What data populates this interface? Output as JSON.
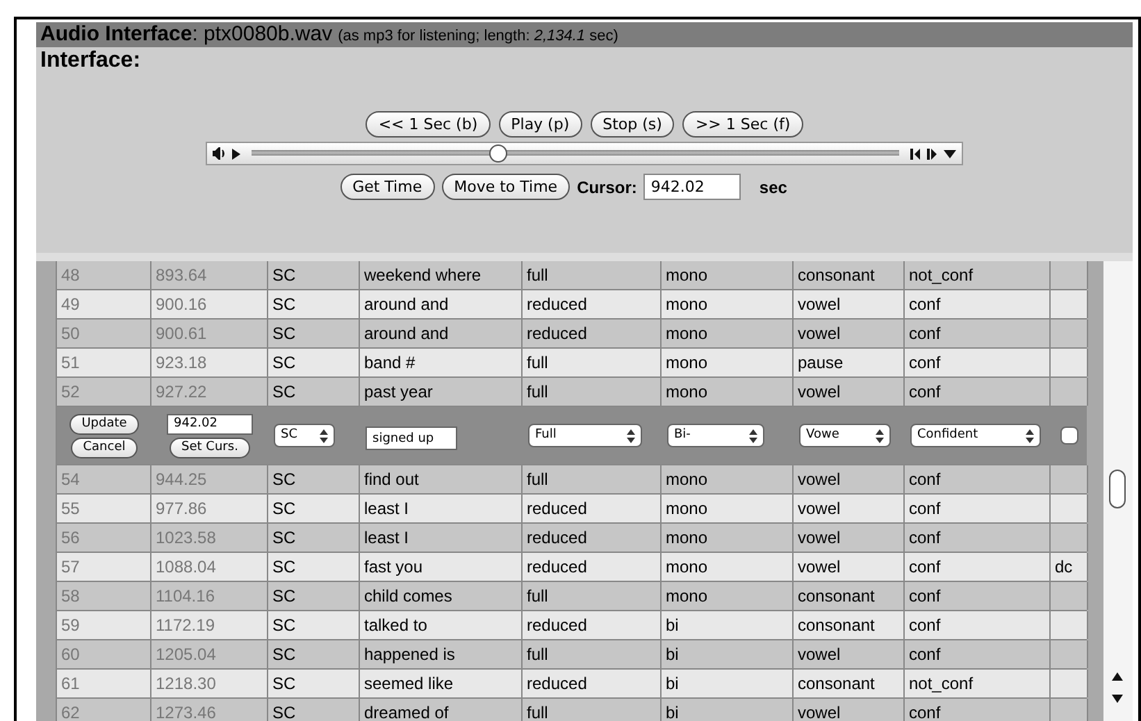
{
  "header": {
    "label": "Audio Interface",
    "filename": ": ptx0080b.wav",
    "note": "(as mp3 for listening; length: *2,134.1* sec)"
  },
  "interface": {
    "title": "Interface:",
    "transport_buttons": [
      "<< 1 Sec (b)",
      "Play (p)",
      "Stop (s)",
      ">> 1 Sec (f)"
    ],
    "player": {
      "level": 0.38
    },
    "time_buttons": [
      "Get Time",
      "Move to Time"
    ],
    "cursor_label": "Cursor:",
    "cursor_value": "942.02",
    "cursor_unit": "sec"
  },
  "rows_before": [
    {
      "cells": [
        "48",
        "893.64",
        "SC",
        "weekend where",
        "full",
        "mono",
        "consonant",
        "not_conf",
        ""
      ]
    },
    {
      "cells": [
        "49",
        "900.16",
        "SC",
        "around and",
        "reduced",
        "mono",
        "vowel",
        "conf",
        ""
      ]
    },
    {
      "cells": [
        "50",
        "900.61",
        "SC",
        "around and",
        "reduced",
        "mono",
        "vowel",
        "conf",
        ""
      ]
    },
    {
      "cells": [
        "51",
        "923.18",
        "SC",
        "band #",
        "full",
        "mono",
        "pause",
        "conf",
        ""
      ]
    },
    {
      "cells": [
        "52",
        "927.22",
        "SC",
        "past year",
        "full",
        "mono",
        "vowel",
        "conf",
        ""
      ]
    }
  ],
  "edit_row": {
    "update": "Update",
    "cancel": "Cancel",
    "time": "942.02",
    "set_cursor": "Set Curs.",
    "speaker": "SC",
    "words": "signed up",
    "selects": [
      "Full",
      "Bi-",
      "Vowe",
      "Confident"
    ],
    "checked": false
  },
  "rows_after": [
    {
      "cells": [
        "54",
        "944.25",
        "SC",
        "find out",
        "full",
        "mono",
        "vowel",
        "conf",
        ""
      ]
    },
    {
      "cells": [
        "55",
        "977.86",
        "SC",
        "least I",
        "reduced",
        "mono",
        "vowel",
        "conf",
        ""
      ]
    },
    {
      "cells": [
        "56",
        "1023.58",
        "SC",
        "least I",
        "reduced",
        "mono",
        "vowel",
        "conf",
        ""
      ]
    },
    {
      "cells": [
        "57",
        "1088.04",
        "SC",
        "fast you",
        "reduced",
        "mono",
        "vowel",
        "conf",
        "dc"
      ]
    },
    {
      "cells": [
        "58",
        "1104.16",
        "SC",
        "child comes",
        "full",
        "mono",
        "consonant",
        "conf",
        ""
      ]
    },
    {
      "cells": [
        "59",
        "1172.19",
        "SC",
        "talked to",
        "reduced",
        "bi",
        "consonant",
        "conf",
        ""
      ]
    },
    {
      "cells": [
        "60",
        "1205.04",
        "SC",
        "happened is",
        "full",
        "bi",
        "vowel",
        "conf",
        ""
      ]
    },
    {
      "cells": [
        "61",
        "1218.30",
        "SC",
        "seemed like",
        "reduced",
        "bi",
        "consonant",
        "not_conf",
        ""
      ]
    },
    {
      "cells": [
        "62",
        "1273.46",
        "SC",
        "dreamed of",
        "full",
        "bi",
        "vowel",
        "conf",
        ""
      ]
    }
  ]
}
